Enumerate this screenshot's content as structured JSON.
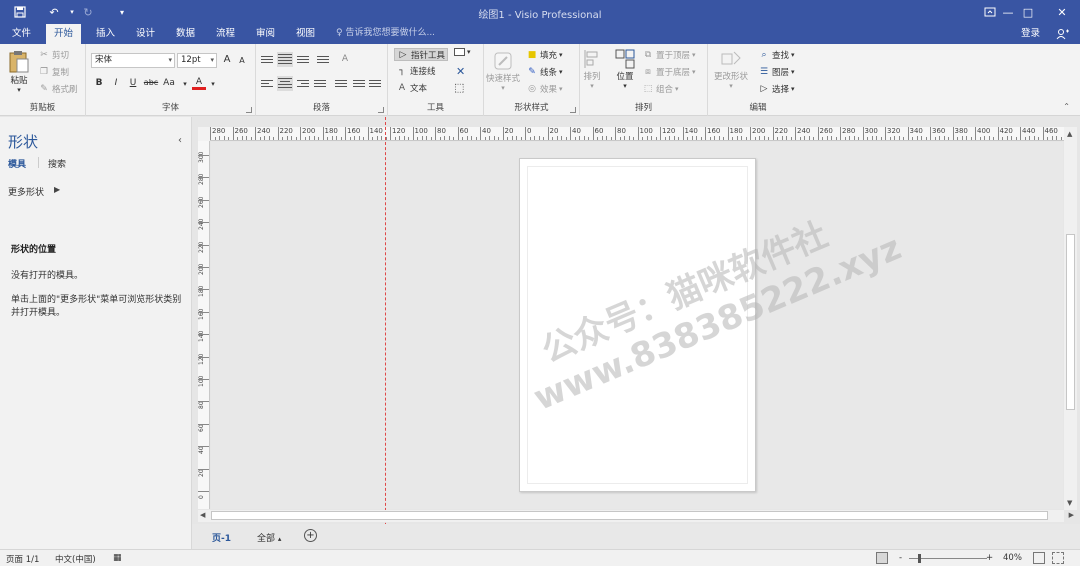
{
  "titlebar": {
    "title": "绘图1 - Visio Professional",
    "icons": [
      "save-icon",
      "undo-icon",
      "redo-icon",
      "customize-icon"
    ],
    "window_controls": [
      "restore-ribbon-icon",
      "minimize-icon",
      "maximize-icon",
      "close-icon"
    ]
  },
  "tabs": {
    "items": [
      "文件",
      "开始",
      "插入",
      "设计",
      "数据",
      "流程",
      "审阅",
      "视图"
    ],
    "active": "开始",
    "tell_me": "告诉我您想要做什么...",
    "login": "登录"
  },
  "ribbon": {
    "clipboard": {
      "label": "剪贴板",
      "paste": "粘贴",
      "cut": "剪切",
      "copy": "复制",
      "format_painter": "格式刷"
    },
    "font": {
      "label": "字体",
      "font_name": "宋体",
      "font_size": "12pt",
      "bold": "B",
      "italic": "I",
      "underline": "U",
      "strike": "abc",
      "case": "Aa",
      "color": "A",
      "grow": "A",
      "shrink": "A"
    },
    "paragraph": {
      "label": "段落"
    },
    "tools": {
      "label": "工具",
      "pointer": "指针工具",
      "connector": "连接线",
      "text": "文本"
    },
    "shape_styles": {
      "label": "形状样式",
      "quick_styles": "快速样式",
      "fill": "填充",
      "line": "线条",
      "effects": "效果"
    },
    "arrange": {
      "label": "排列",
      "align": "排列",
      "position": "位置",
      "bring_front": "置于顶层",
      "send_back": "置于底层",
      "group": "组合"
    },
    "editing": {
      "label": "编辑",
      "change_shape": "更改形状",
      "find": "查找",
      "layers": "图层",
      "select": "选择"
    }
  },
  "shapes_panel": {
    "title": "形状",
    "tab_stencils": "模具",
    "tab_search": "搜索",
    "more_shapes": "更多形状",
    "section_title": "形状的位置",
    "no_stencils": "没有打开的模具。",
    "hint": "单击上面的\"更多形状\"菜单可浏览形状类别并打开模具。"
  },
  "ruler": {
    "horizontal_labels": [
      "280",
      "260",
      "240",
      "220",
      "200",
      "180",
      "160",
      "140",
      "120",
      "100",
      "80",
      "60",
      "40",
      "20",
      "0",
      "20",
      "40",
      "60",
      "80",
      "100",
      "120",
      "140",
      "160",
      "180",
      "200",
      "220",
      "240",
      "260",
      "280",
      "300",
      "320",
      "340",
      "360",
      "380",
      "400",
      "420",
      "440",
      "460"
    ],
    "vertical_labels": [
      "300",
      "280",
      "260",
      "240",
      "220",
      "200",
      "180",
      "160",
      "140",
      "120",
      "100",
      "80",
      "60",
      "40",
      "20",
      "0"
    ]
  },
  "watermark": {
    "line1": "公众号：猫咪软件社",
    "line2": "www.838385222.xyz"
  },
  "page_tabs": {
    "page": "页-1",
    "all": "全部",
    "add": "+"
  },
  "status": {
    "page_info": "页面 1/1",
    "language": "中文(中国)",
    "zoom": "40%",
    "zoom_minus": "-",
    "zoom_plus": "+"
  },
  "colors": {
    "title_bar": "#3955a3",
    "accent": "#2b579a",
    "guide": "#e04848",
    "ribbon": "#f3f3f3",
    "canvas": "#e8e8e8"
  }
}
